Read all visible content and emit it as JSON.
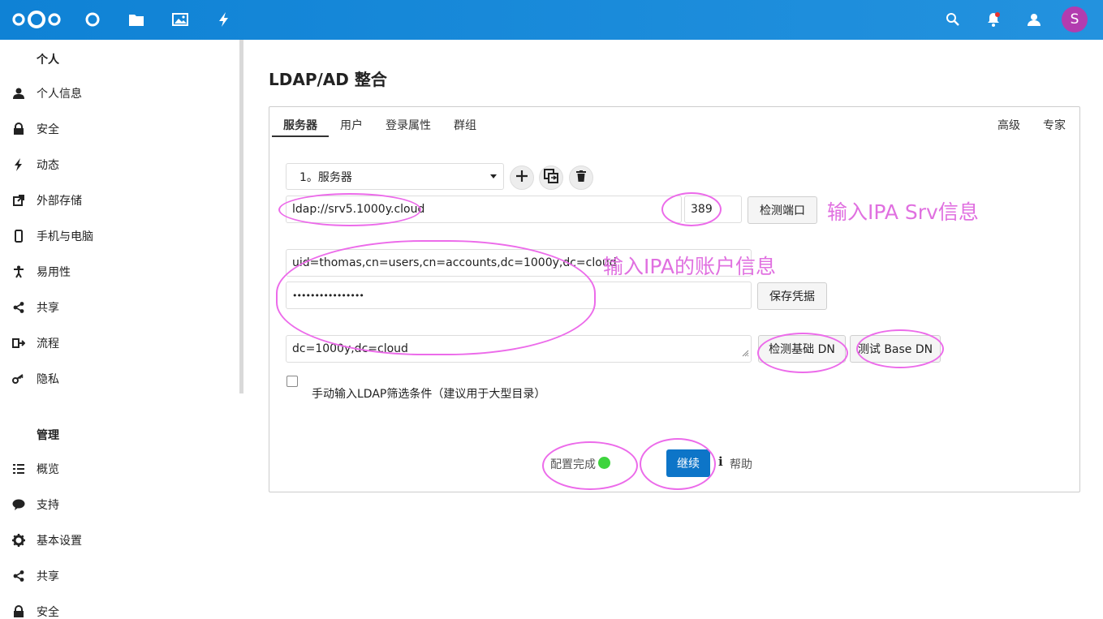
{
  "header": {
    "icons": [
      "nextcloud-logo-icon",
      "dashboard-icon",
      "files-icon",
      "photos-icon",
      "activity-icon",
      "search-icon",
      "notifications-icon",
      "contacts-icon"
    ],
    "avatar_letter": "S",
    "avatar_color": "#b23caf",
    "brand_color": "#1a88d8"
  },
  "sidebar": {
    "personal_caption": "个人",
    "personal_items": [
      {
        "label": "个人信息",
        "icon": "user-icon"
      },
      {
        "label": "安全",
        "icon": "lock-icon"
      },
      {
        "label": "动态",
        "icon": "activity-icon"
      },
      {
        "label": "外部存储",
        "icon": "external-storage-icon"
      },
      {
        "label": "手机与电脑",
        "icon": "phone-icon"
      },
      {
        "label": "易用性",
        "icon": "accessibility-icon"
      },
      {
        "label": "共享",
        "icon": "share-icon"
      },
      {
        "label": "流程",
        "icon": "flow-icon"
      },
      {
        "label": "隐私",
        "icon": "key-icon"
      }
    ],
    "admin_caption": "管理",
    "admin_items": [
      {
        "label": "概览",
        "icon": "overview-icon"
      },
      {
        "label": "支持",
        "icon": "support-icon"
      },
      {
        "label": "基本设置",
        "icon": "gear-icon"
      },
      {
        "label": "共享",
        "icon": "share-icon"
      },
      {
        "label": "安全",
        "icon": "lock-icon"
      }
    ]
  },
  "main": {
    "title": "LDAP/AD 整合",
    "tabs": [
      "服务器",
      "用户",
      "登录属性",
      "群组"
    ],
    "right_tabs": [
      "高级",
      "专家"
    ],
    "server_select": "1。服务器",
    "host_value": "ldap://srv5.1000y.cloud",
    "port_value": "389",
    "detect_port_label": "检测端口",
    "user_dn_value": "uid=thomas,cn=users,cn=accounts,dc=1000y,dc=cloud",
    "password_value": "••••••••••••••••",
    "save_credentials_label": "保存凭据",
    "base_dn_value": "dc=1000y,dc=cloud",
    "detect_base_dn_label": "检测基础 DN",
    "test_base_dn_label": "测试 Base DN",
    "manual_filter_label": "手动输入LDAP筛选条件（建议用于大型目录）",
    "config_status_label": "配置完成",
    "status_color": "#3ed43e",
    "continue_label": "继续",
    "help_label": "帮助"
  },
  "annotations": {
    "srv_note": "输入IPA Srv信息",
    "account_note": "输入IPA的账户信息"
  }
}
